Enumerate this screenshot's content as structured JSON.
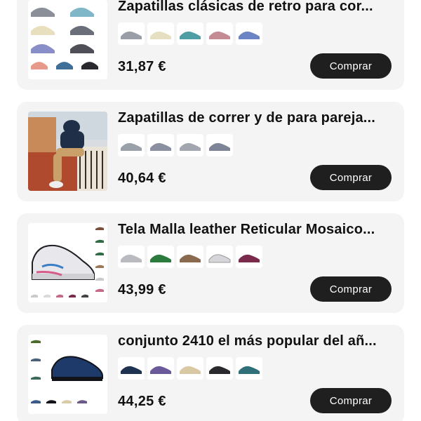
{
  "products": [
    {
      "title": "Zapatillas clásicas de retro para cor...",
      "price": "31,87 €",
      "buy_label": "Comprar",
      "thumb_colors": [
        "#8b8f98",
        "#7fb7c9",
        "#e8dfbf",
        "#6a9ba8",
        "#8a8ec8",
        "#4e4f57",
        "#c9c2cf",
        "#a7a0b8",
        "#e89a8a",
        "#3f6f98",
        "#2a2a2e"
      ],
      "swatch_colors": [
        "#9a9ea6",
        "#e6dfc2",
        "#4f9ea4",
        "#c48b95",
        "#6a84c4"
      ]
    },
    {
      "title": "Zapatillas de correr y de para pareja...",
      "price": "40,64 €",
      "buy_label": "Comprar",
      "thumb_colors": [
        "#b04a2e",
        "#1f2f47",
        "#c9a06a",
        "#e9e3d8",
        "#3a2a22"
      ],
      "swatch_colors": [
        "#9aa0a8",
        "#8a90a0",
        "#a2a6ae",
        "#7d8496"
      ]
    },
    {
      "title": "Tela Malla leather Reticular Mosaico...",
      "price": "43,99 €",
      "buy_label": "Comprar",
      "thumb_colors": [
        "#e8e8ec",
        "#1f1f24",
        "#3c7fc6",
        "#d65a8a",
        "#2f6b45",
        "#7a4f3c",
        "#c56a8a"
      ],
      "swatch_colors": [
        "#b9bbc0",
        "#2d7a3e",
        "#8a6a4f",
        "#e1e1e4",
        "#7a2a4a"
      ]
    },
    {
      "title": "conjunto 2410 el más popular del añ...",
      "price": "44,25 €",
      "buy_label": "Comprar",
      "thumb_colors": [
        "#1e3a6a",
        "#111318",
        "#4a6b2a",
        "#4d5f7a",
        "#d8cba8",
        "#6a5a8a"
      ],
      "swatch_colors": [
        "#1e3352",
        "#6a5a9a",
        "#d8c8a4",
        "#2a2a2e",
        "#2f6f7a"
      ]
    }
  ]
}
